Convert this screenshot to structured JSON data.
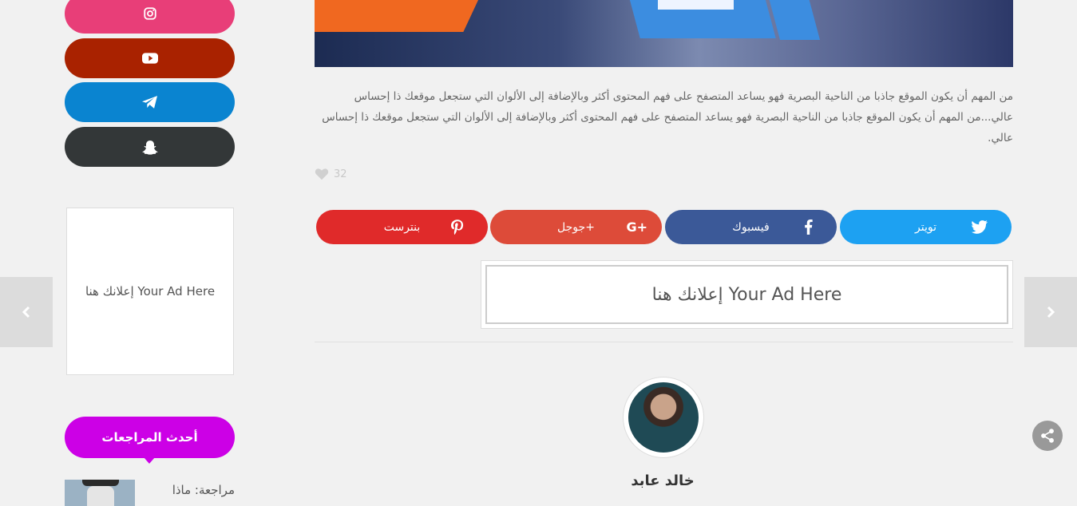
{
  "sidebar": {
    "social": [
      {
        "name": "instagram",
        "icon": "instagram-icon",
        "color": "#e83e78"
      },
      {
        "name": "youtube",
        "icon": "youtube-icon",
        "color": "#a92200"
      },
      {
        "name": "telegram",
        "icon": "telegram-icon",
        "color": "#0a84d0"
      },
      {
        "name": "snapchat",
        "icon": "snapchat-icon",
        "color": "#333738"
      }
    ],
    "ad_text": "إعلانك هنا  Your Ad Here",
    "widget_title": "أحدث المراجعات",
    "review_label": "مراجعة: ماذا"
  },
  "article": {
    "paragraph": "من المهم أن يكون الموقع جاذبا من الناحية البصرية فهو يساعد المتصفح على فهم المحتوى أكثر وبالإضافة إلى الألوان التي ستجعل موقعك ذا إحساس عالي...من المهم أن يكون الموقع جاذبا من الناحية البصرية فهو يساعد المتصفح على فهم المحتوى أكثر وبالإضافة إلى الألوان التي ستجعل موقعك ذا إحساس عالي.",
    "likes": "32"
  },
  "share": {
    "twitter": {
      "label": "تويتر",
      "color": "#1da1f2"
    },
    "facebook": {
      "label": "فيسبوك",
      "color": "#3b5998"
    },
    "google": {
      "label": "جوجل+",
      "color": "#dd4b39"
    },
    "pinterest": {
      "label": "بنترست",
      "color": "#e02a2a"
    }
  },
  "ad_main_text": "إعلانك هنا  Your Ad Here",
  "author": {
    "name": "خالد عابد"
  }
}
